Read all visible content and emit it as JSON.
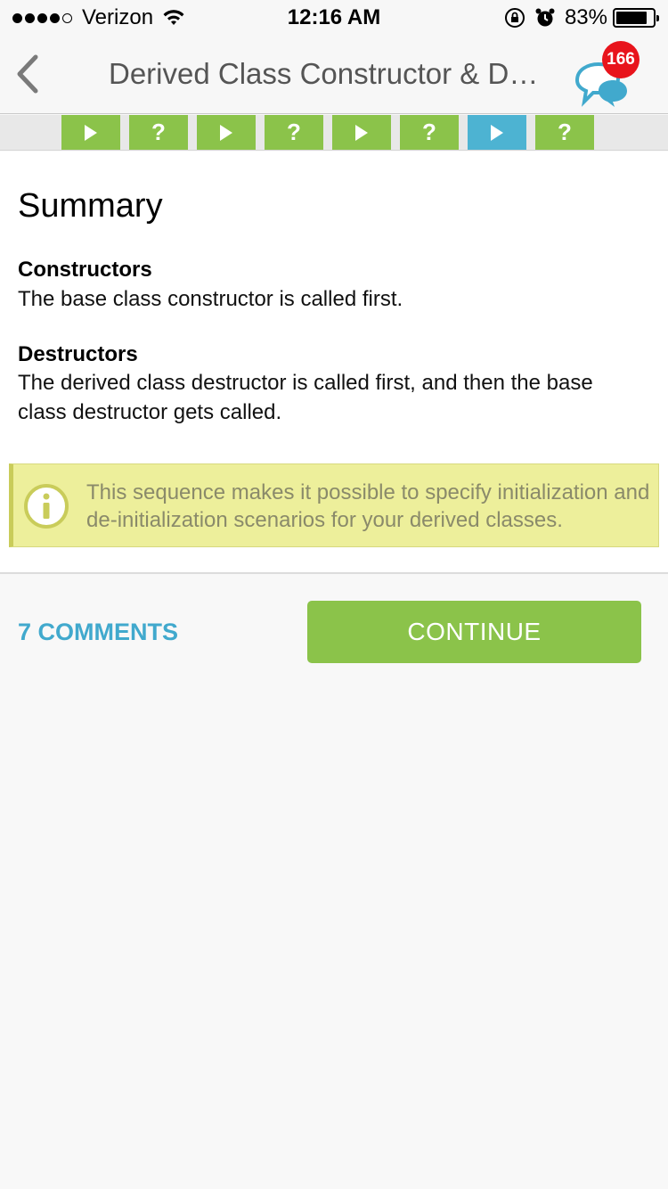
{
  "status_bar": {
    "carrier": "Verizon",
    "time": "12:16 AM",
    "battery_percent": "83%",
    "signal_bars_filled": 4,
    "signal_bars_total": 5,
    "battery_level": 0.83
  },
  "nav": {
    "title": "Derived Class Constructor & De…",
    "back_icon": "chevron-left-icon",
    "chat_icon": "chat-bubbles-icon",
    "badge_count": "166"
  },
  "progress": {
    "steps": [
      {
        "type": "play",
        "state": "done"
      },
      {
        "type": "question",
        "state": "done"
      },
      {
        "type": "play",
        "state": "done"
      },
      {
        "type": "question",
        "state": "done"
      },
      {
        "type": "play",
        "state": "done"
      },
      {
        "type": "question",
        "state": "done"
      },
      {
        "type": "play",
        "state": "current"
      },
      {
        "type": "question",
        "state": "done"
      }
    ],
    "question_glyph": "?"
  },
  "content": {
    "title": "Summary",
    "sections": [
      {
        "heading": "Constructors",
        "text": "The base class constructor is called first."
      },
      {
        "heading": "Destructors",
        "text": "The derived class destructor is called first, and then the base class destructor gets called."
      }
    ],
    "note": {
      "icon": "info-icon",
      "text": "This sequence makes it possible to specify initialization and de-initialization scenarios for your derived classes."
    }
  },
  "footer": {
    "comments_label": "7 COMMENTS",
    "continue_label": "CONTINUE"
  },
  "colors": {
    "accent_green": "#8bc34a",
    "accent_blue": "#4db3d2",
    "badge_red": "#e8141c",
    "note_bg": "#edef9b",
    "link_blue": "#41a9cd"
  }
}
